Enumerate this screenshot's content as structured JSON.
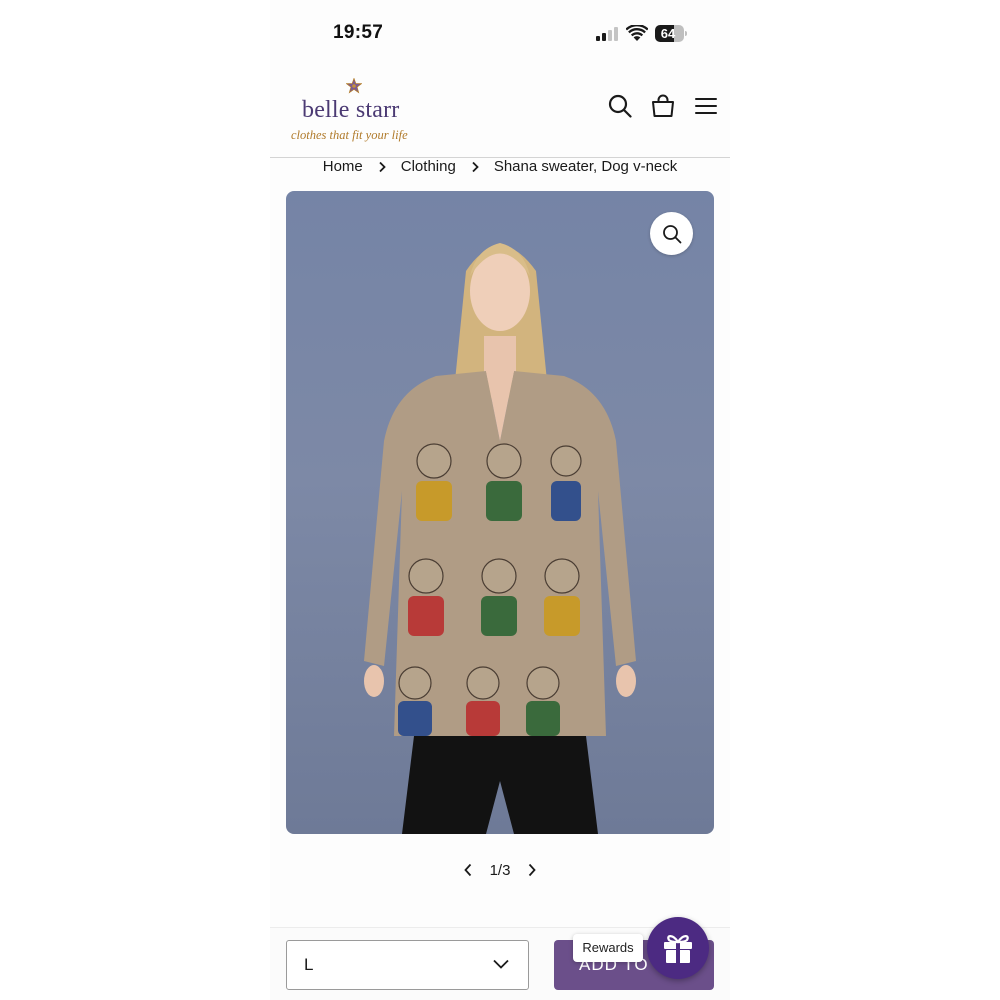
{
  "status_bar": {
    "time": "19:57",
    "battery": "64",
    "battery_level": 0.64
  },
  "header": {
    "logo_name": "belle starr",
    "logo_tagline": "clothes that fit your life",
    "icons": [
      "search-icon",
      "cart-icon",
      "menu-icon"
    ]
  },
  "breadcrumb": {
    "items": [
      "Home",
      "Clothing",
      "Shana sweater, Dog v-neck"
    ]
  },
  "gallery": {
    "pager_text": "1/3"
  },
  "purchase": {
    "size_selected": "L",
    "add_to_cart_label": "ADD TO CART"
  },
  "rewards": {
    "label": "Rewards"
  },
  "colors": {
    "brand_purple": "#4b3a73",
    "tagline_gold": "#b07a2a",
    "cart_button": "#6b4f8a",
    "rewards_button": "#4c2a82"
  }
}
